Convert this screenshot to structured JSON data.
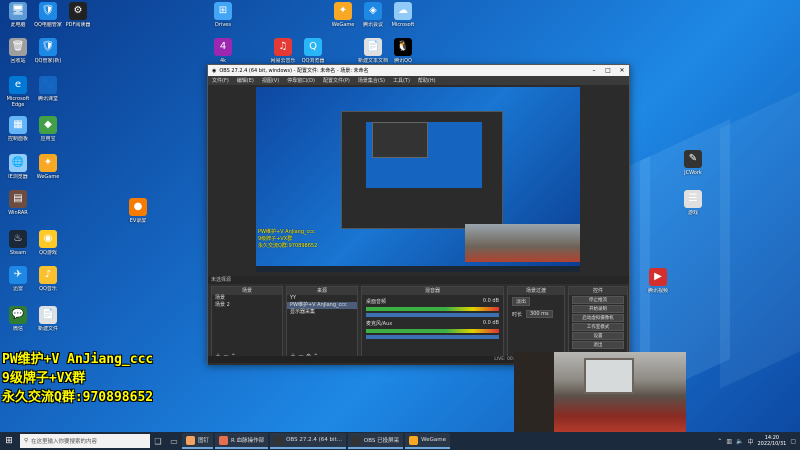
{
  "desktop": {
    "icons": [
      {
        "label": "此电脑",
        "color": "#5c9bd6",
        "glyph": "🖥"
      },
      {
        "label": "QQ电脑管家",
        "color": "#1e88e5",
        "glyph": "🛡"
      },
      {
        "label": "PDF阅读器",
        "color": "#222222",
        "glyph": "⚙"
      },
      {
        "label": "回收站",
        "color": "#9e9e9e",
        "glyph": "🗑"
      },
      {
        "label": "QQ管家(新)",
        "color": "#1e88e5",
        "glyph": "🛡"
      },
      {
        "label": "Microsoft Edge",
        "color": "#0078d4",
        "glyph": "e"
      },
      {
        "label": "腾讯课堂",
        "color": "#1565c0",
        "glyph": "🐾"
      },
      {
        "label": "控制面板",
        "color": "#64b5f6",
        "glyph": "▦"
      },
      {
        "label": "应用宝",
        "color": "#43a047",
        "glyph": "◆"
      },
      {
        "label": "IE浏览器",
        "color": "#90caf9",
        "glyph": "🌐"
      },
      {
        "label": "WeGame",
        "color": "#f9a825",
        "glyph": "✦"
      },
      {
        "label": "WinRAR",
        "color": "#6d4c41",
        "glyph": "▤"
      },
      {
        "label": "EV录屏",
        "color": "#f57c00",
        "glyph": "●"
      },
      {
        "label": "Steam",
        "color": "#1b2838",
        "glyph": "♨"
      },
      {
        "label": "QQ游戏",
        "color": "#ffca28",
        "glyph": "◉"
      },
      {
        "label": "迅雷",
        "color": "#1e88e5",
        "glyph": "✈"
      },
      {
        "label": "QQ音乐",
        "color": "#fbc02d",
        "glyph": "♪"
      },
      {
        "label": "微信",
        "color": "#2e7d32",
        "glyph": "💬"
      },
      {
        "label": "新建文件",
        "color": "#e0e0e0",
        "glyph": "📄"
      },
      {
        "label": "腾讯视频",
        "color": "#d32f2f",
        "glyph": "▶"
      },
      {
        "label": "Drives",
        "color": "#42a5f5",
        "glyph": "⊞"
      },
      {
        "label": "4k",
        "color": "#9c27b0",
        "glyph": "4"
      },
      {
        "label": "网易云音乐",
        "color": "#e53935",
        "glyph": "♫"
      },
      {
        "label": "QQ浏览器",
        "color": "#29b6f6",
        "glyph": "Q"
      },
      {
        "label": "WeGame",
        "color": "#f9a825",
        "glyph": "✦"
      },
      {
        "label": "腾讯会议",
        "color": "#1e88e5",
        "glyph": "◈"
      },
      {
        "label": "Microsoft",
        "color": "#90caf9",
        "glyph": "☁"
      },
      {
        "label": "腾讯QQ",
        "color": "#000000",
        "glyph": "🐧"
      },
      {
        "label": "JCWork",
        "color": "#333333",
        "glyph": "✎"
      },
      {
        "label": "游戏",
        "color": "#e0e0e0",
        "glyph": "☰"
      },
      {
        "label": "新建文本文档",
        "color": "#e0e0e0",
        "glyph": "📄"
      }
    ],
    "stream_text": [
      "PW维护+V AnJiang_ccc",
      "9级牌子+VX群",
      "永久交流Q群:970898652"
    ]
  },
  "obs": {
    "title": "OBS 27.2.4 (64 bit, windows) - 配置文件: 未命名 - 场景: 未命名",
    "menu": [
      "文件(F)",
      "编辑(E)",
      "视图(V)",
      "停靠窗口(D)",
      "配置文件(P)",
      "场景集合(S)",
      "工具(T)",
      "帮助(H)"
    ],
    "docks_label": "未选择源",
    "scenes": {
      "title": "场景",
      "items": [
        "场景",
        "场景 2"
      ]
    },
    "sources": {
      "title": "来源",
      "items": [
        "YY",
        "PW维护+V AnJiang_ccc",
        "显示器采集"
      ]
    },
    "mixer": {
      "title": "混音器",
      "channels": [
        "桌面音频",
        "麦克风/Aux"
      ],
      "levels": [
        "0.0 dB",
        "0.0 dB"
      ]
    },
    "transitions": {
      "title": "场景过渡",
      "type": "淡出",
      "duration_label": "时长",
      "duration": "300 ms"
    },
    "controls": {
      "title": "控件",
      "buttons": [
        "停止推流",
        "开始录制",
        "启动虚拟摄像机",
        "工作室模式",
        "设置",
        "退出"
      ]
    },
    "status": {
      "live": "LIVE: 00:00:00",
      "rec": "REC: 00:00:00",
      "cpu": "CPU: 2.4%, 30.00 fps"
    },
    "preview_overlay": [
      "PW维护+V AnJiang_ccc",
      "9级牌子+VX群",
      "永久交流Q群:970898652"
    ]
  },
  "taskbar": {
    "search_placeholder": "在这里输入你要搜索的内容",
    "apps": [
      {
        "label": "图钉",
        "color": "#f4a261"
      },
      {
        "label": "R 血脉操作部",
        "color": "#e76f51"
      },
      {
        "label": "OBS 27.2.4 (64 bit...",
        "color": "#333333"
      },
      {
        "label": "OBS 已投屏采",
        "color": "#333333"
      },
      {
        "label": "WeGame",
        "color": "#f9a825"
      }
    ],
    "time": "14:20",
    "date": "2022/10/31",
    "lang": "中"
  }
}
